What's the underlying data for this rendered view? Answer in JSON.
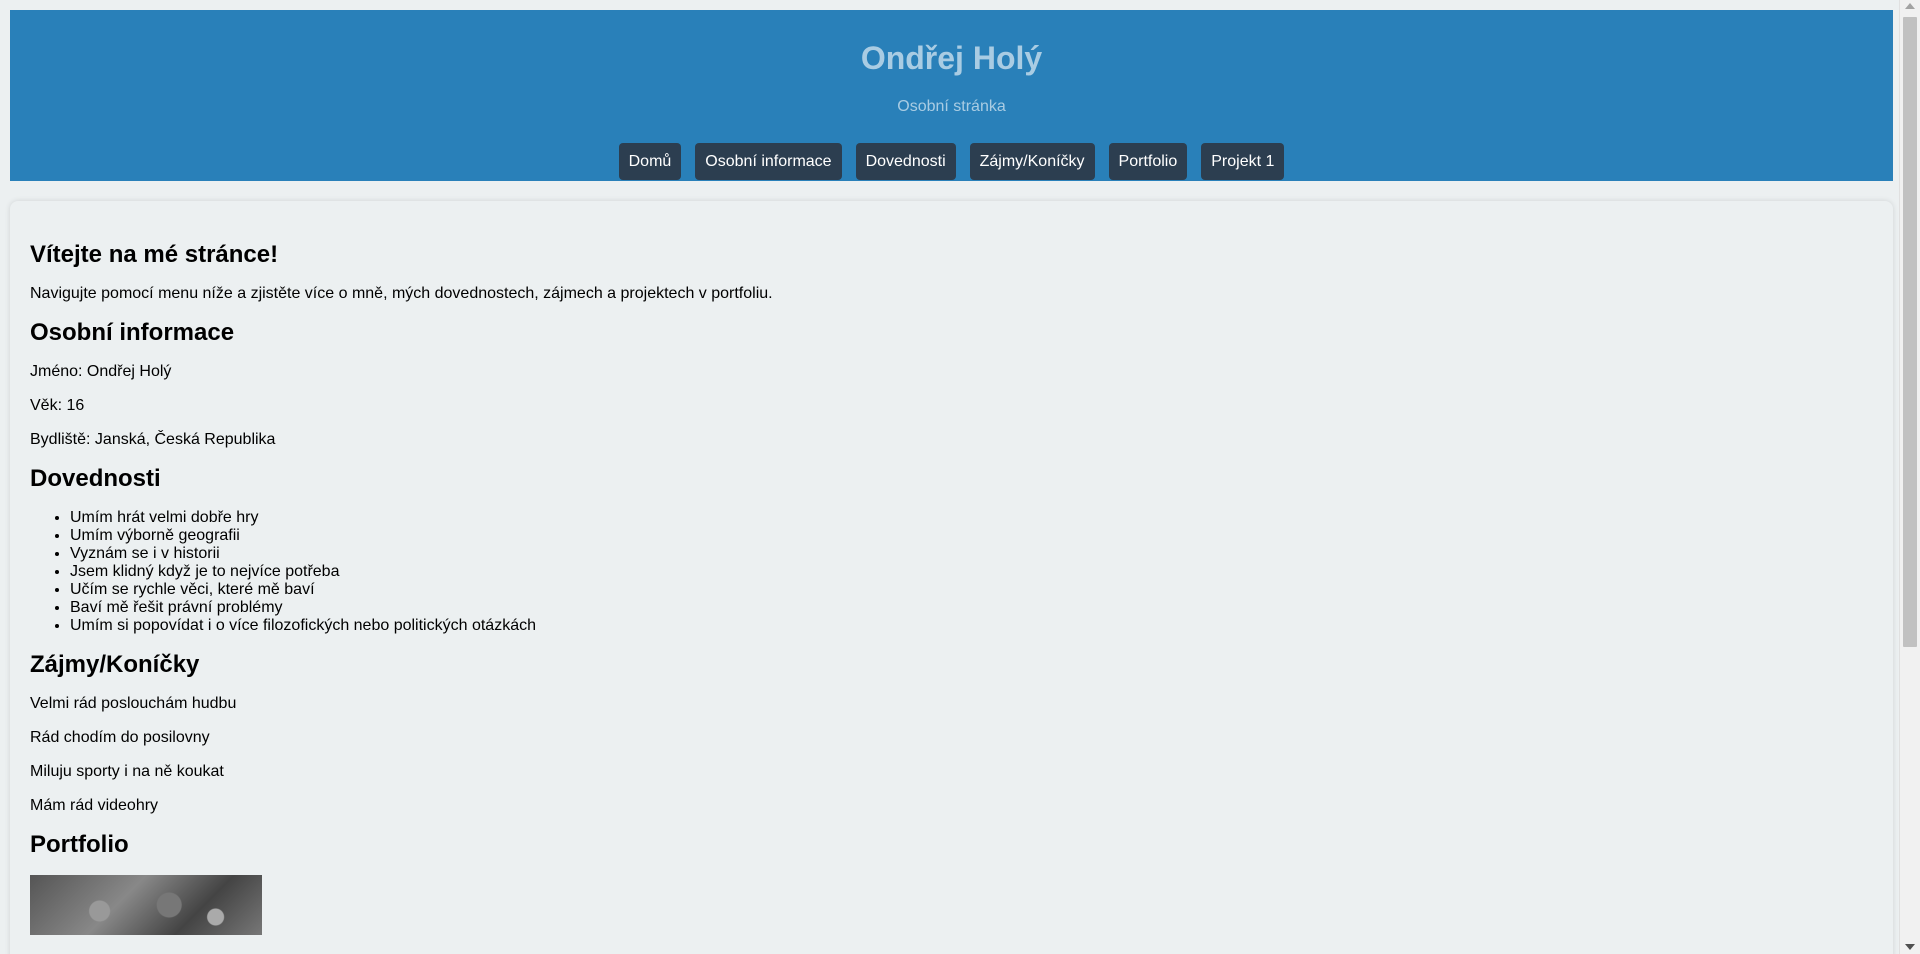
{
  "header": {
    "title": "Ondřej Holý",
    "subtitle": "Osobní stránka"
  },
  "nav": {
    "items": [
      "Domů",
      "Osobní informace",
      "Dovednosti",
      "Zájmy/Koníčky",
      "Portfolio",
      "Projekt 1"
    ]
  },
  "welcome": {
    "heading": "Vítejte na mé stránce!",
    "text": "Navigujte pomocí menu níže a zjistěte více o mně, mých dovednostech, zájmech a projektech v portfoliu."
  },
  "personal": {
    "heading": "Osobní informace",
    "name": "Jméno: Ondřej Holý",
    "age": "Věk: 16",
    "residence": "Bydliště: Janská, Česká Republika"
  },
  "skills": {
    "heading": "Dovednosti",
    "items": [
      "Umím hrát velmi dobře hry",
      "Umím výborně geografii",
      "Vyznám se i v historii",
      "Jsem klidný když je to nejvíce potřeba",
      "Učím se rychle věci, které mě baví",
      "Baví mě řešit právní problémy",
      "Umím si popovídat i o více filozofických nebo politických otázkách"
    ]
  },
  "hobbies": {
    "heading": "Zájmy/Koníčky",
    "items": [
      "Velmi rád poslouchám hudbu",
      "Rád chodím do posilovny",
      "Miluju sporty i na ně koukat",
      "Mám rád videohry"
    ]
  },
  "portfolio": {
    "heading": "Portfolio"
  },
  "colors": {
    "header_bg": "#2980b9",
    "header_text": "#a9cce3",
    "nav_bg": "#2c3e50",
    "page_bg": "#ecf0f1"
  }
}
